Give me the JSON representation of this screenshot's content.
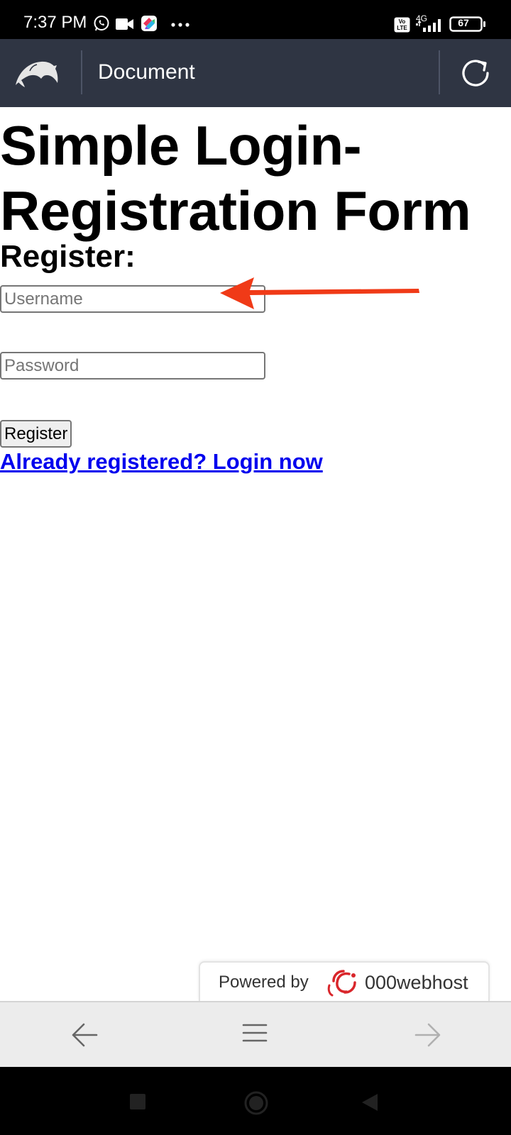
{
  "status_bar": {
    "time": "7:37 PM",
    "network_label": "4G",
    "battery_level": "67",
    "icons": [
      "whatsapp-icon",
      "video-camera-icon",
      "app-icon",
      "more-dots-icon",
      "volte-icon",
      "signal-icon",
      "battery-icon"
    ]
  },
  "browser": {
    "page_title": "Document",
    "icons": [
      "dolphin-logo-icon",
      "reload-icon"
    ]
  },
  "page": {
    "heading": "Simple Login-Registration Form",
    "form_heading": "Register:",
    "username_placeholder": "Username",
    "username_value": "",
    "password_placeholder": "Password",
    "password_value": "",
    "register_button": "Register",
    "login_link": "Already registered? Login now",
    "annotation": {
      "icon": "red-arrow-icon",
      "color": "#f03a17"
    }
  },
  "badge": {
    "prefix": "Powered by",
    "brand": "000webhost",
    "icon": "000webhost-logo-icon"
  },
  "bottom_nav": {
    "icons": [
      "back-arrow-icon",
      "menu-icon",
      "forward-arrow-icon"
    ]
  },
  "system_nav": {
    "icons": [
      "recents-icon",
      "home-icon",
      "back-triangle-icon"
    ]
  }
}
